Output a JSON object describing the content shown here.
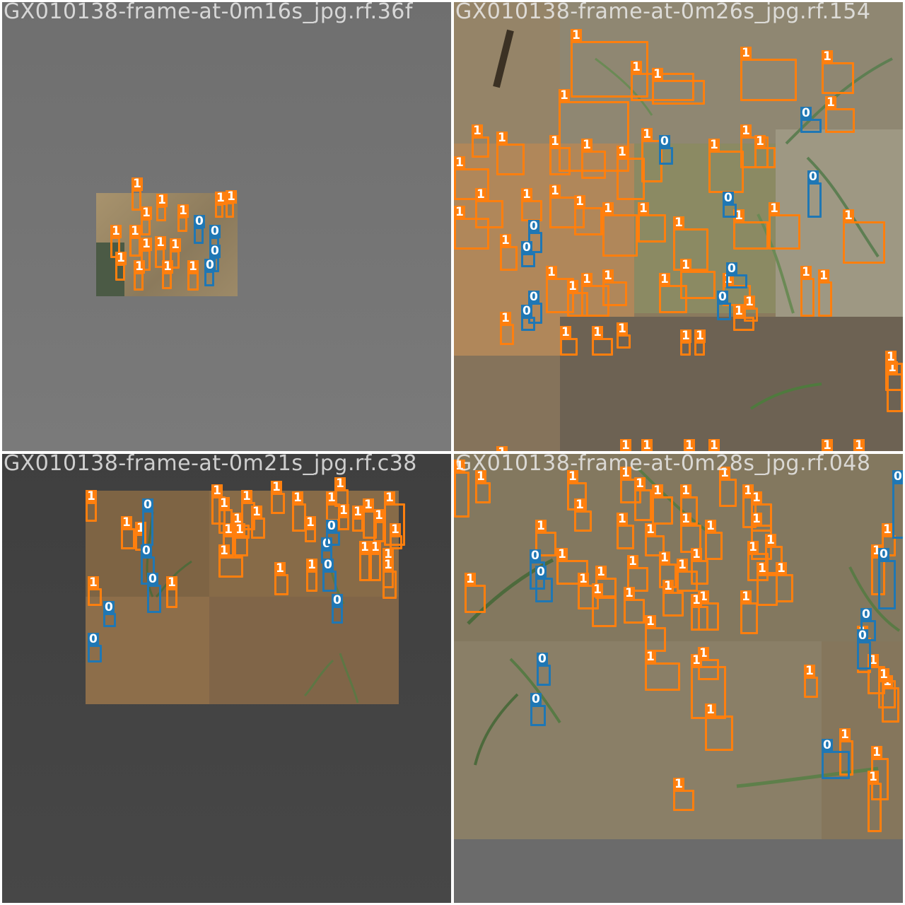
{
  "tiles": [
    {
      "title": "GX010138-frame-at-0m16s_jpg.rf.36f"
    },
    {
      "title": "GX010138-frame-at-0m26s_jpg.rf.154"
    },
    {
      "title": "GX010138-frame-at-0m21s_jpg.rf.c38"
    },
    {
      "title": "GX010138-frame-at-0m28s_jpg.rf.048"
    }
  ],
  "classes": {
    "0": {
      "label": "0",
      "color": "#1f77b4"
    },
    "1": {
      "label": "1",
      "color": "#ff7f0e"
    }
  },
  "colors": {
    "soil": "#9a8460",
    "soil_dark": "#6f5f45",
    "leaf": "#4f6f3a",
    "gray_bg": "#727272",
    "dark_bg": "#434343"
  }
}
